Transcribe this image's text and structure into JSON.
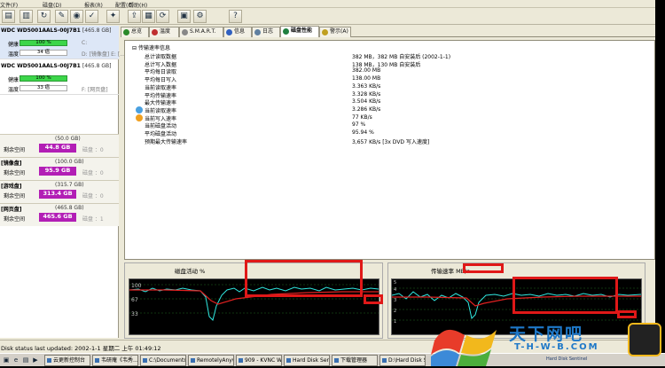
{
  "menu": [
    "文件(F)",
    "磁盘(D)",
    "报表(R)",
    "配置(C)",
    "帮助(H)"
  ],
  "toolbar_icons": [
    "open-icon",
    "save-icon",
    "refresh-icon",
    "wizard-icon",
    "disk-icon",
    "check-icon",
    "tools-icon",
    "export-icon",
    "report-icon",
    "options-icon",
    "sync-icon",
    "network-icon",
    "settings-icon",
    "help-icon"
  ],
  "disks": [
    {
      "title": "WDC WD5001AALS-00J7B1",
      "size": "[465.8 GB]",
      "health_label": "健康：",
      "health_value": "100 %",
      "temp_label": "温度：",
      "temp_value": "34 癌",
      "partition_top": "C:",
      "partition_bottom": "D: [镜像盘]  E: [...]",
      "selected": true
    },
    {
      "title": "WDC WD5001AALS-00J7B1",
      "size": "[465.8 GB]",
      "health_label": "健康：",
      "health_value": "100 %",
      "temp_label": "温度：",
      "temp_value": "33 癌",
      "partition_top": "",
      "partition_bottom": "F: [网页盘]",
      "selected": false
    }
  ],
  "volumes": [
    {
      "name": "",
      "size": "(50.0 GB)",
      "free_label": "剩余空间",
      "free_value": "44.8 GB",
      "extra": "磁盘 ：0"
    },
    {
      "name": "[镜像盘]",
      "size": "(100.0 GB)",
      "free_label": "剩余空间",
      "free_value": "95.9 GB",
      "extra": "磁盘 ：0"
    },
    {
      "name": "[游戏盘]",
      "size": "(315.7 GB)",
      "free_label": "剩余空间",
      "free_value": "313.4 GB",
      "extra": "磁盘 ：0"
    },
    {
      "name": "[网页盘]",
      "size": "(465.8 GB)",
      "free_label": "剩余空间",
      "free_value": "465.6 GB",
      "extra": "磁盘 ：1"
    }
  ],
  "tabs": [
    {
      "label": "总览",
      "icon": "check-icon",
      "color": "#2a8a2a",
      "active": false
    },
    {
      "label": "温度",
      "icon": "thermometer-icon",
      "color": "#c03030",
      "active": false
    },
    {
      "label": "S.M.A.R.T.",
      "icon": "smart-icon",
      "color": "#888888",
      "active": false
    },
    {
      "label": "信息",
      "icon": "info-icon",
      "color": "#3060c0",
      "active": false
    },
    {
      "label": "日志",
      "icon": "log-icon",
      "color": "#6080a0",
      "active": false
    },
    {
      "label": "磁盘性能",
      "icon": "performance-icon",
      "color": "#208040",
      "active": true
    },
    {
      "label": "警示(A)",
      "icon": "alert-icon",
      "color": "#c0a020",
      "active": false
    }
  ],
  "info": {
    "title": "传输速率信息",
    "rows": [
      {
        "label": "总计读取数据",
        "value": "382 MB，382 MB 自安装后 (2002-1-1)",
        "dot": ""
      },
      {
        "label": "总计写入数据",
        "value": "138 MB，130 MB 自安装后",
        "dot": ""
      },
      {
        "label": "平均每日读取",
        "value": "382.00 MB",
        "dot": ""
      },
      {
        "label": "平均每日写入",
        "value": "138.00 MB",
        "dot": ""
      },
      {
        "label": "当前读取速率",
        "value": "3.363 KB/s",
        "dot": ""
      },
      {
        "label": "平均传输速率",
        "value": "3.328 KB/s",
        "dot": ""
      },
      {
        "label": "最大传输速率",
        "value": "3.504 KB/s",
        "dot": ""
      },
      {
        "label": "当前读取速率",
        "value": "3.286 KB/s",
        "dot": "#4aa0e0"
      },
      {
        "label": "当前写入速率",
        "value": "77 KB/s",
        "dot": "#f0a020"
      },
      {
        "label": "当前磁盘活动",
        "value": "97 %",
        "dot": ""
      },
      {
        "label": "平均磁盘活动",
        "value": "95.94 %",
        "dot": ""
      },
      {
        "label": "预期最大传输速率",
        "value": "3,657 KB/s [3x DVD 写入速度]",
        "dot": ""
      }
    ]
  },
  "charts": {
    "activity": {
      "title": "磁盘活动 %",
      "y_ticks": [
        "100",
        "67",
        "33"
      ]
    },
    "transfer": {
      "title": "传输速率",
      "unit": "MB/s",
      "y_ticks": [
        "5",
        "4",
        "3",
        "2",
        "1"
      ]
    }
  },
  "status": "Disk status last updated: 2002-1-1 星期二 上午 01:49:12",
  "taskbar": {
    "quick_icons": [
      "show-desktop-icon",
      "ie-icon",
      "explorer-icon",
      "media-icon"
    ],
    "tasks": [
      "云更新控制台",
      "韦研庵《韦秀...",
      "C:\\Documents ...",
      "RemotelyAnyw...",
      "909 - KVNC We...",
      "Hard Disk Senti...",
      "下载管理器",
      "D:\\Hard Disk S..."
    ]
  },
  "watermark": {
    "text": "天下网吧",
    "sub": "T-H-W-B.COM",
    "extra": "Hard Disk Sentinel"
  }
}
